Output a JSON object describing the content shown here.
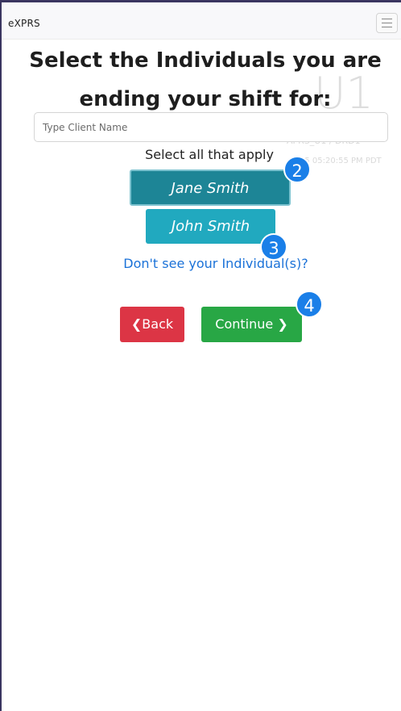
{
  "navbar": {
    "brand": "eXPRS",
    "menu_icon": "hamburger-icon"
  },
  "heading": {
    "line1": "Select the Individuals you are",
    "line2": "ending your shift for:"
  },
  "background_overlay": {
    "big_text": "U1",
    "line1": "APRS_U1 / DRD1",
    "line2": "25 05:20:55 PM PDT"
  },
  "search": {
    "placeholder": "Type Client Name",
    "value": ""
  },
  "instruction": "Select all that apply",
  "clients": [
    {
      "name": "Jane Smith",
      "selected": true
    },
    {
      "name": "John Smith",
      "selected": false
    }
  ],
  "missing_link": "Don't see your Individual(s)?",
  "actions": {
    "back_label": "Back",
    "continue_label": "Continue"
  },
  "step_markers": [
    "2",
    "3",
    "4"
  ],
  "colors": {
    "primary_teal": "#1d8596",
    "secondary_teal": "#21a9bf",
    "danger": "#dc3545",
    "success": "#28a745",
    "link": "#1b72d8",
    "marker": "#1a7fe8"
  }
}
